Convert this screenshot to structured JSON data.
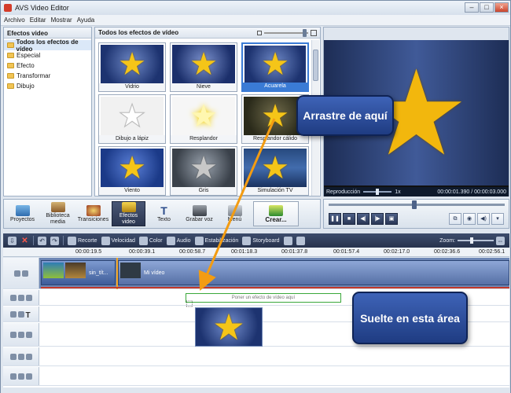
{
  "window": {
    "title": "AVS Video Editor"
  },
  "menu": [
    "Archivo",
    "Editar",
    "Mostrar",
    "Ayuda"
  ],
  "left_panel": {
    "title": "Efectos video",
    "items": [
      "Todos los efectos de vídeo",
      "Especial",
      "Efecto",
      "Transformar",
      "Dibujo"
    ]
  },
  "mid_panel": {
    "title": "Todos los efectos de vídeo"
  },
  "effects": [
    {
      "label": "Vidrio"
    },
    {
      "label": "Nieve"
    },
    {
      "label": "Acuarela"
    },
    {
      "label": "Dibujo a lápiz"
    },
    {
      "label": "Resplandor"
    },
    {
      "label": "Resplandor cálido"
    },
    {
      "label": "Viento"
    },
    {
      "label": "Gris"
    },
    {
      "label": "Simulación TV"
    }
  ],
  "preview": {
    "label": "Reproducción",
    "speed": "1x",
    "time": "00:00:01.390 / 00:00:03.000"
  },
  "toolbar": {
    "proyectos": "Proyectos",
    "biblioteca": "Biblioteca media",
    "transiciones": "Transiciones",
    "efectos": "Efectos video",
    "texto": "Texto",
    "grabar": "Grabar voz",
    "menu": "Menú",
    "crear": "Crear..."
  },
  "timeline_tools": {
    "recorte": "Recorte",
    "velocidad": "Velocidad",
    "color": "Color",
    "audio": "Audio",
    "estabilizacion": "Estabilización",
    "storyboard": "Storyboard",
    "zoom": "Zoom:"
  },
  "ruler": [
    "00:00:19.5",
    "00:00:39.1",
    "00:00:58.7",
    "00:01:18.3",
    "00:01:37.8",
    "00:01:57.4",
    "00:02:17.0",
    "00:02:36.6",
    "00:02:56.1"
  ],
  "clips": {
    "clip1": "sin_tít...",
    "clip2": "Mi vídeo"
  },
  "drop_zone": "Poner un efecto de vídeo aquí",
  "callouts": {
    "drag_from": "Arrastre de aquí",
    "drop_here": "Suelte en esta área"
  },
  "colors": {
    "accent": "#3a7bd5",
    "callout": "#2f4f9e",
    "arrow": "#f39c12",
    "drop_border": "#3aa83a"
  }
}
